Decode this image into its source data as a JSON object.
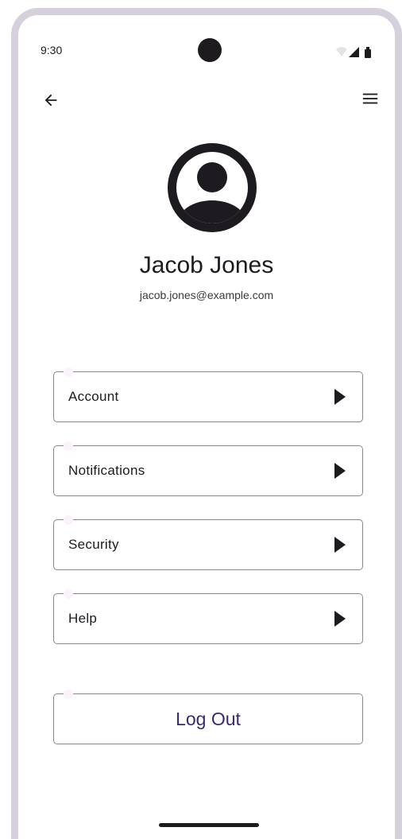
{
  "status_bar": {
    "time": "9:30",
    "icons": [
      "wifi-icon",
      "cellular-signal-icon",
      "battery-icon"
    ]
  },
  "toolbar": {
    "back_icon": "arrow-left-icon",
    "menu_icon": "hamburger-menu-icon"
  },
  "profile": {
    "avatar_icon": "account-circle-icon",
    "name": "Jacob Jones",
    "email": "jacob.jones@example.com"
  },
  "menu": {
    "items": [
      {
        "label": "Account",
        "icon": "play-arrow-icon"
      },
      {
        "label": "Notifications",
        "icon": "play-arrow-icon"
      },
      {
        "label": "Security",
        "icon": "play-arrow-icon"
      },
      {
        "label": "Help",
        "icon": "play-arrow-icon"
      }
    ]
  },
  "logout": {
    "label": "Log Out"
  },
  "colors": {
    "frame": "#d6d0dc",
    "text": "#1d1b20",
    "accent_text": "#3b2a6e",
    "outline": "#8a868e"
  }
}
